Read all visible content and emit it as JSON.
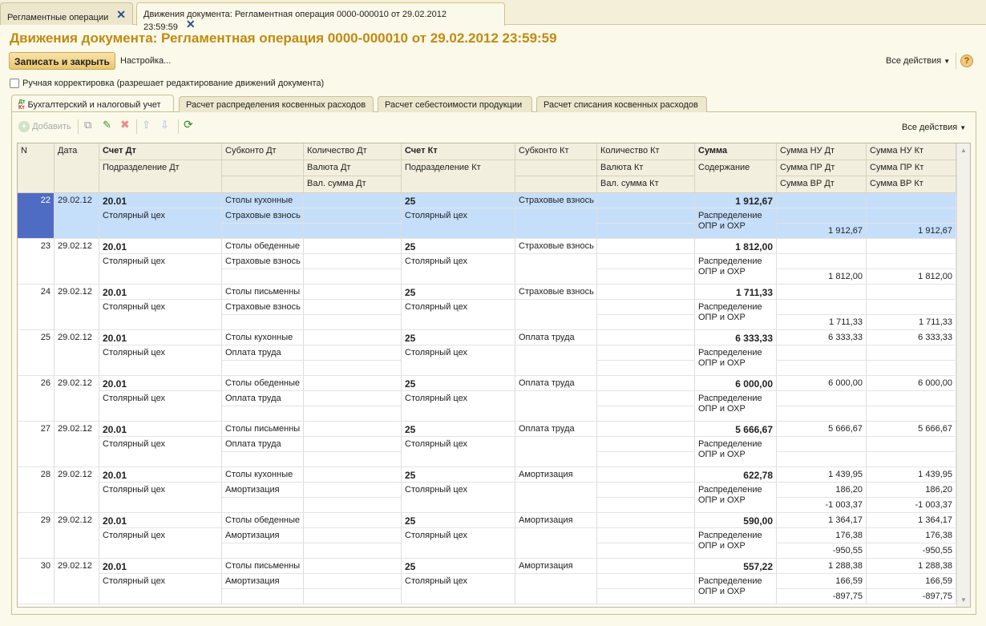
{
  "window_tabs": [
    {
      "label": "Регламентные операции"
    },
    {
      "label": "Движения документа: Регламентная операция 0000-000010 от 29.02.2012 23:59:59"
    }
  ],
  "title": "Движения документа: Регламентная операция 0000-000010 от 29.02.2012 23:59:59",
  "toolbar": {
    "save_close": "Записать и закрыть",
    "settings": "Настройка...",
    "all_actions": "Все действия",
    "help": "?"
  },
  "manual_correction": {
    "label": "Ручная корректировка (разрешает редактирование движений документа)",
    "checked": false
  },
  "tabs": [
    {
      "label": "Бухгалтерский и налоговый учет",
      "icon_text": "Дт Кт"
    },
    {
      "label": "Расчет распределения косвенных расходов"
    },
    {
      "label": "Расчет себестоимости продукции"
    },
    {
      "label": "Расчет списания косвенных расходов"
    }
  ],
  "table_toolbar": {
    "add": "Добавить",
    "all_actions": "Все действия"
  },
  "columns": {
    "n": "N",
    "date": "Дата",
    "acc_dt": "Счет Дт",
    "div_dt": "Подразделение Дт",
    "sub_dt": "Субконто Дт",
    "qty_dt": "Количество Дт",
    "cur_dt": "Валюта Дт",
    "cursum_dt": "Вал. сумма Дт",
    "acc_kt": "Счет Кт",
    "div_kt": "Подразделение Кт",
    "sub_kt": "Субконто Кт",
    "qty_kt": "Количество Кт",
    "cur_kt": "Валюта Кт",
    "cursum_kt": "Вал. сумма Кт",
    "sum": "Сумма",
    "content": "Содержание",
    "nu_dt": "Сумма НУ Дт",
    "pr_dt": "Сумма ПР Дт",
    "vr_dt": "Сумма ВР Дт",
    "nu_kt": "Сумма НУ Кт",
    "pr_kt": "Сумма ПР Кт",
    "vr_kt": "Сумма ВР Кт"
  },
  "rows": [
    {
      "n": "22",
      "date": "29.02.12",
      "acc_dt": "20.01",
      "div_dt": "Столярный цех",
      "sub_dt1": "Столы кухонные",
      "sub_dt2": "Страховые взнось",
      "acc_kt": "25",
      "div_kt": "Столярный цех",
      "sub_kt1": "Страховые взнось",
      "sum": "1 912,67",
      "content1": "Распределение",
      "content2": "ОПР и ОХР",
      "tax_dt": [
        "",
        "",
        "1 912,67"
      ],
      "tax_kt": [
        "",
        "",
        "1 912,67"
      ],
      "selected": true
    },
    {
      "n": "23",
      "date": "29.02.12",
      "acc_dt": "20.01",
      "div_dt": "Столярный цех",
      "sub_dt1": "Столы обеденные",
      "sub_dt2": "Страховые взнось",
      "acc_kt": "25",
      "div_kt": "Столярный цех",
      "sub_kt1": "Страховые взнось",
      "sum": "1 812,00",
      "content1": "Распределение",
      "content2": "ОПР и ОХР",
      "tax_dt": [
        "",
        "",
        "1 812,00"
      ],
      "tax_kt": [
        "",
        "",
        "1 812,00"
      ]
    },
    {
      "n": "24",
      "date": "29.02.12",
      "acc_dt": "20.01",
      "div_dt": "Столярный цех",
      "sub_dt1": "Столы письменны",
      "sub_dt2": "Страховые взнось",
      "acc_kt": "25",
      "div_kt": "Столярный цех",
      "sub_kt1": "Страховые взнось",
      "sum": "1 711,33",
      "content1": "Распределение",
      "content2": "ОПР и ОХР",
      "tax_dt": [
        "",
        "",
        "1 711,33"
      ],
      "tax_kt": [
        "",
        "",
        "1 711,33"
      ]
    },
    {
      "n": "25",
      "date": "29.02.12",
      "acc_dt": "20.01",
      "div_dt": "Столярный цех",
      "sub_dt1": "Столы кухонные",
      "sub_dt2": "Оплата труда",
      "acc_kt": "25",
      "div_kt": "Столярный цех",
      "sub_kt1": "Оплата труда",
      "sum": "6 333,33",
      "content1": "Распределение",
      "content2": "ОПР и ОХР",
      "tax_dt": [
        "6 333,33",
        "",
        ""
      ],
      "tax_kt": [
        "6 333,33",
        "",
        ""
      ]
    },
    {
      "n": "26",
      "date": "29.02.12",
      "acc_dt": "20.01",
      "div_dt": "Столярный цех",
      "sub_dt1": "Столы обеденные",
      "sub_dt2": "Оплата труда",
      "acc_kt": "25",
      "div_kt": "Столярный цех",
      "sub_kt1": "Оплата труда",
      "sum": "6 000,00",
      "content1": "Распределение",
      "content2": "ОПР и ОХР",
      "tax_dt": [
        "6 000,00",
        "",
        ""
      ],
      "tax_kt": [
        "6 000,00",
        "",
        ""
      ]
    },
    {
      "n": "27",
      "date": "29.02.12",
      "acc_dt": "20.01",
      "div_dt": "Столярный цех",
      "sub_dt1": "Столы письменны",
      "sub_dt2": "Оплата труда",
      "acc_kt": "25",
      "div_kt": "Столярный цех",
      "sub_kt1": "Оплата труда",
      "sum": "5 666,67",
      "content1": "Распределение",
      "content2": "ОПР и ОХР",
      "tax_dt": [
        "5 666,67",
        "",
        ""
      ],
      "tax_kt": [
        "5 666,67",
        "",
        ""
      ]
    },
    {
      "n": "28",
      "date": "29.02.12",
      "acc_dt": "20.01",
      "div_dt": "Столярный цех",
      "sub_dt1": "Столы кухонные",
      "sub_dt2": "Амортизация",
      "acc_kt": "25",
      "div_kt": "Столярный цех",
      "sub_kt1": "Амортизация",
      "sum": "622,78",
      "content1": "Распределение",
      "content2": "ОПР и ОХР",
      "tax_dt": [
        "1 439,95",
        "186,20",
        "-1 003,37"
      ],
      "tax_kt": [
        "1 439,95",
        "186,20",
        "-1 003,37"
      ]
    },
    {
      "n": "29",
      "date": "29.02.12",
      "acc_dt": "20.01",
      "div_dt": "Столярный цех",
      "sub_dt1": "Столы обеденные",
      "sub_dt2": "Амортизация",
      "acc_kt": "25",
      "div_kt": "Столярный цех",
      "sub_kt1": "Амортизация",
      "sum": "590,00",
      "content1": "Распределение",
      "content2": "ОПР и ОХР",
      "tax_dt": [
        "1 364,17",
        "176,38",
        "-950,55"
      ],
      "tax_kt": [
        "1 364,17",
        "176,38",
        "-950,55"
      ]
    },
    {
      "n": "30",
      "date": "29.02.12",
      "acc_dt": "20.01",
      "div_dt": "Столярный цех",
      "sub_dt1": "Столы письменны",
      "sub_dt2": "Амортизация",
      "acc_kt": "25",
      "div_kt": "Столярный цех",
      "sub_kt1": "Амортизация",
      "sum": "557,22",
      "content1": "Распределение",
      "content2": "ОПР и ОХР",
      "tax_dt": [
        "1 288,38",
        "166,59",
        "-897,75"
      ],
      "tax_kt": [
        "1 288,38",
        "166,59",
        "-897,75"
      ]
    }
  ],
  "colors": {
    "accent": "#c08a12",
    "selected_row": "#c5dffb",
    "selected_n": "#4f6cc4"
  }
}
